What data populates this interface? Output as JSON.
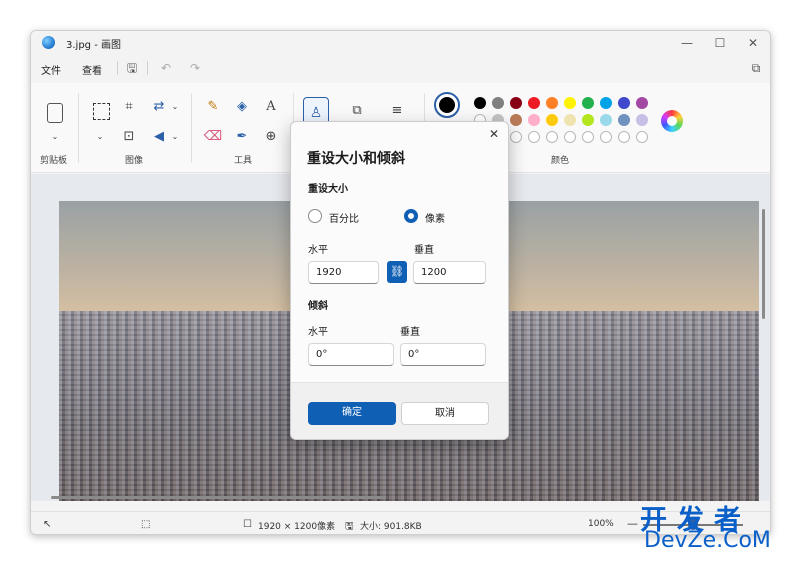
{
  "titlebar": {
    "title": "3.jpg - 画图",
    "minimize": "—",
    "maximize": "☐",
    "close": "✕"
  },
  "menubar": {
    "file": "文件",
    "view": "查看"
  },
  "ribbon": {
    "groups": {
      "clipboard": "剪贴板",
      "image": "图像",
      "tools": "工具",
      "colors": "颜色"
    },
    "tools": {
      "text": "A"
    }
  },
  "colors": {
    "accent": "#0f5fb5",
    "active_color": "#000000",
    "row1": [
      "#000000",
      "#7f7f7f",
      "#880015",
      "#ed1c24",
      "#ff7f27",
      "#fff200",
      "#22b14c",
      "#00a2e8",
      "#3f48cc",
      "#a349a4"
    ],
    "row2": [
      "#ffffff",
      "#c3c3c3",
      "#b97a57",
      "#ffaec9",
      "#ffc90e",
      "#efe4b0",
      "#b5e61d",
      "#99d9ea",
      "#7092be",
      "#c8bfe7"
    ]
  },
  "dialog": {
    "title": "重设大小和倾斜",
    "resize_section": "重设大小",
    "radio_percent": "百分比",
    "radio_pixels": "像素",
    "horizontal_label": "水平",
    "vertical_label": "垂直",
    "width_value": "1920",
    "height_value": "1200",
    "skew_section": "倾斜",
    "skew_h_label": "水平",
    "skew_v_label": "垂直",
    "skew_h_value": "0°",
    "skew_v_value": "0°",
    "ok": "确定",
    "cancel": "取消",
    "selected_mode": "pixels"
  },
  "statusbar": {
    "dimensions": "1920 × 1200像素",
    "size": "大小: 901.8KB",
    "zoom": "100%",
    "zoom_level": 0.5
  },
  "watermark": {
    "top": "开发者",
    "bottom": "DevZe.CoM"
  }
}
